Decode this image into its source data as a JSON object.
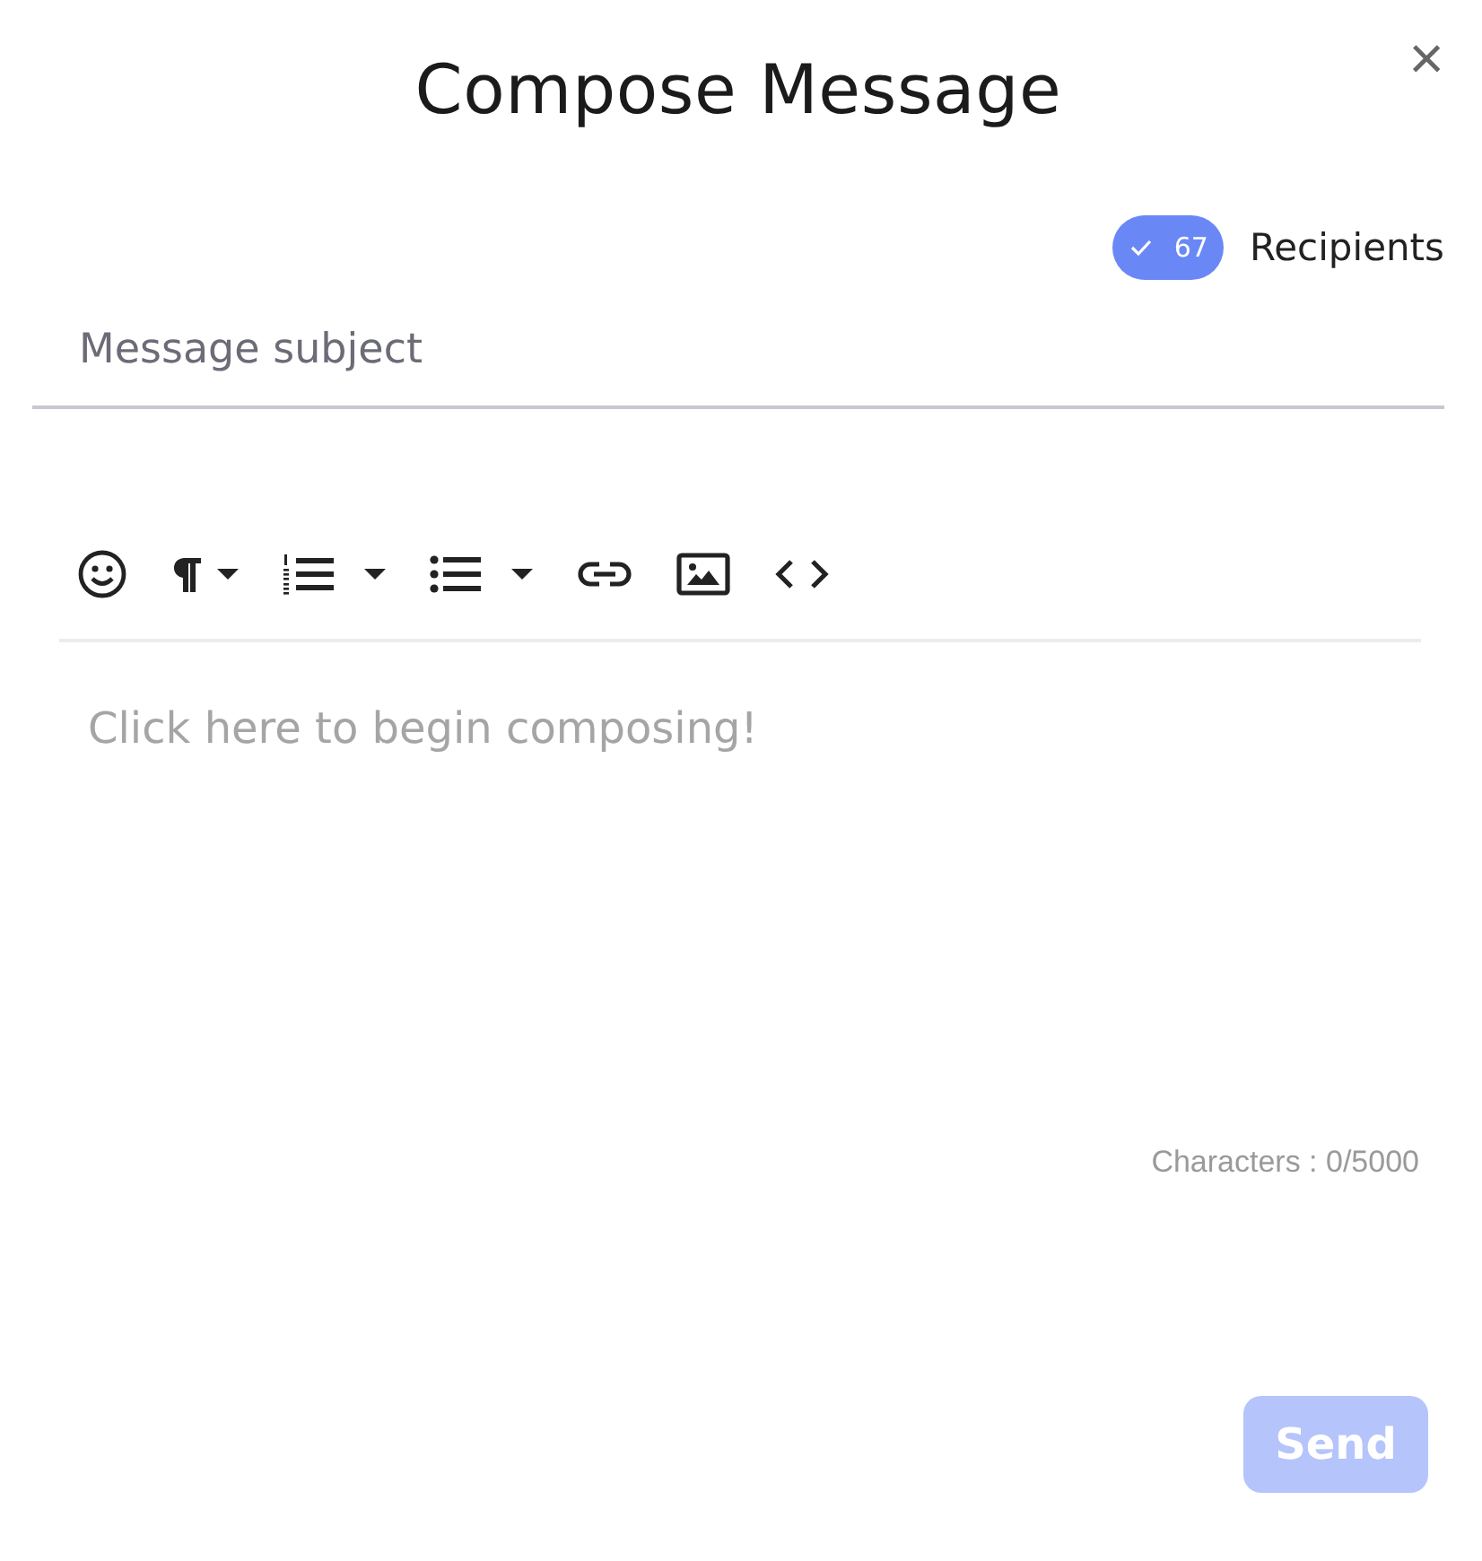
{
  "dialog": {
    "title": "Compose Message",
    "close": "×"
  },
  "recipients": {
    "count": "67",
    "label": "Recipients",
    "checked": true
  },
  "subject": {
    "placeholder": "Message subject"
  },
  "toolbar": [
    {
      "kind": "emoji",
      "dropdown": false
    },
    {
      "kind": "paragraph",
      "dropdown": true
    },
    {
      "kind": "ordered-list",
      "dropdown": true
    },
    {
      "kind": "bullet-list",
      "dropdown": true
    },
    {
      "kind": "link",
      "dropdown": false
    },
    {
      "kind": "image",
      "dropdown": false
    },
    {
      "kind": "code",
      "dropdown": false
    }
  ],
  "editor": {
    "placeholder": "Click here to begin composing!",
    "counter": "Characters : 0/5000"
  },
  "send": {
    "label": "Send",
    "disabled": true
  }
}
